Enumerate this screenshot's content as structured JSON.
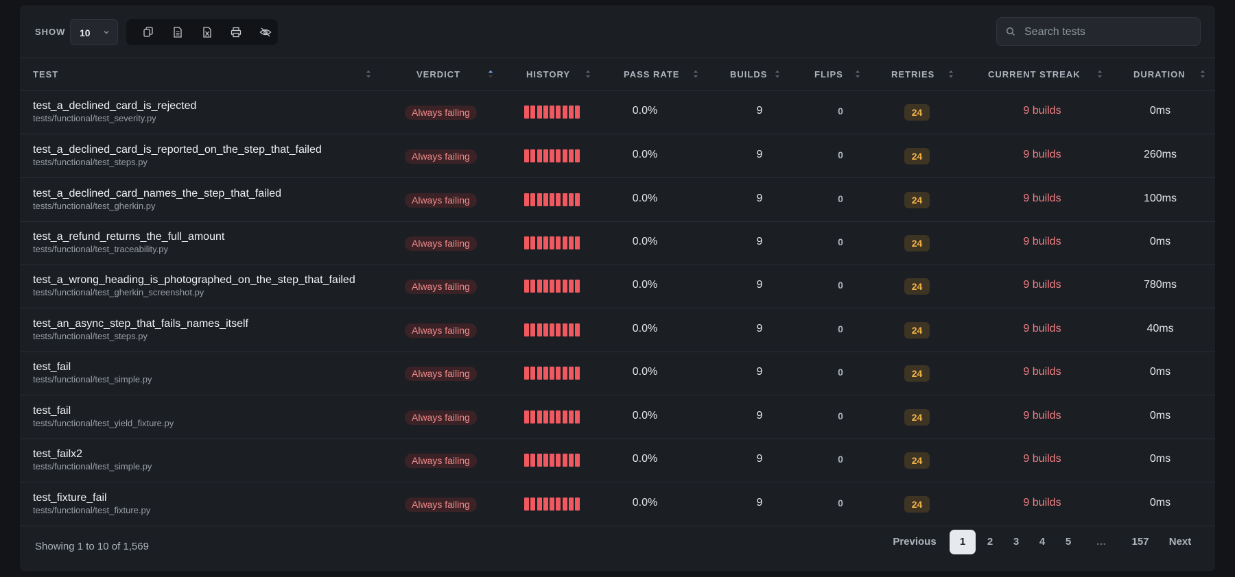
{
  "toolbar": {
    "show_label": "SHOW",
    "page_size": "10",
    "tools": [
      {
        "icon": "copy-icon"
      },
      {
        "icon": "csv-icon"
      },
      {
        "icon": "excel-icon"
      },
      {
        "icon": "print-icon"
      },
      {
        "icon": "column-visibility-icon"
      }
    ],
    "search_placeholder": "Search tests"
  },
  "columns": {
    "test": "TEST",
    "verdict": "VERDICT",
    "history": "HISTORY",
    "pass_rate": "PASS RATE",
    "builds": "BUILDS",
    "flips": "FLIPS",
    "retries": "RETRIES",
    "current_streak": "CURRENT STREAK",
    "duration": "DURATION"
  },
  "colors": {
    "fail": "#f0595f",
    "verdict_text": "#f08a8a",
    "retries": "#f2b447",
    "sort_active": "#7aa7f5"
  },
  "rows": [
    {
      "name": "test_a_declined_card_is_rejected",
      "path": "tests/functional/test_severity.py",
      "verdict": "Always failing",
      "history_failures": 9,
      "pass_rate": "0.0%",
      "builds": "9",
      "flips": "0",
      "retries": "24",
      "streak": "9 builds",
      "duration": "0ms"
    },
    {
      "name": "test_a_declined_card_is_reported_on_the_step_that_failed",
      "path": "tests/functional/test_steps.py",
      "verdict": "Always failing",
      "history_failures": 9,
      "pass_rate": "0.0%",
      "builds": "9",
      "flips": "0",
      "retries": "24",
      "streak": "9 builds",
      "duration": "260ms"
    },
    {
      "name": "test_a_declined_card_names_the_step_that_failed",
      "path": "tests/functional/test_gherkin.py",
      "verdict": "Always failing",
      "history_failures": 9,
      "pass_rate": "0.0%",
      "builds": "9",
      "flips": "0",
      "retries": "24",
      "streak": "9 builds",
      "duration": "100ms"
    },
    {
      "name": "test_a_refund_returns_the_full_amount",
      "path": "tests/functional/test_traceability.py",
      "verdict": "Always failing",
      "history_failures": 9,
      "pass_rate": "0.0%",
      "builds": "9",
      "flips": "0",
      "retries": "24",
      "streak": "9 builds",
      "duration": "0ms"
    },
    {
      "name": "test_a_wrong_heading_is_photographed_on_the_step_that_failed",
      "path": "tests/functional/test_gherkin_screenshot.py",
      "verdict": "Always failing",
      "history_failures": 9,
      "pass_rate": "0.0%",
      "builds": "9",
      "flips": "0",
      "retries": "24",
      "streak": "9 builds",
      "duration": "780ms"
    },
    {
      "name": "test_an_async_step_that_fails_names_itself",
      "path": "tests/functional/test_steps.py",
      "verdict": "Always failing",
      "history_failures": 9,
      "pass_rate": "0.0%",
      "builds": "9",
      "flips": "0",
      "retries": "24",
      "streak": "9 builds",
      "duration": "40ms"
    },
    {
      "name": "test_fail",
      "path": "tests/functional/test_simple.py",
      "verdict": "Always failing",
      "history_failures": 9,
      "pass_rate": "0.0%",
      "builds": "9",
      "flips": "0",
      "retries": "24",
      "streak": "9 builds",
      "duration": "0ms"
    },
    {
      "name": "test_fail",
      "path": "tests/functional/test_yield_fixture.py",
      "verdict": "Always failing",
      "history_failures": 9,
      "pass_rate": "0.0%",
      "builds": "9",
      "flips": "0",
      "retries": "24",
      "streak": "9 builds",
      "duration": "0ms"
    },
    {
      "name": "test_failx2",
      "path": "tests/functional/test_simple.py",
      "verdict": "Always failing",
      "history_failures": 9,
      "pass_rate": "0.0%",
      "builds": "9",
      "flips": "0",
      "retries": "24",
      "streak": "9 builds",
      "duration": "0ms"
    },
    {
      "name": "test_fixture_fail",
      "path": "tests/functional/test_fixture.py",
      "verdict": "Always failing",
      "history_failures": 9,
      "pass_rate": "0.0%",
      "builds": "9",
      "flips": "0",
      "retries": "24",
      "streak": "9 builds",
      "duration": "0ms"
    }
  ],
  "footer": {
    "showing": "Showing 1 to 10 of 1,569",
    "previous": "Previous",
    "pages": [
      "1",
      "2",
      "3",
      "4",
      "5",
      "…",
      "157"
    ],
    "current_page": "1",
    "next": "Next"
  }
}
